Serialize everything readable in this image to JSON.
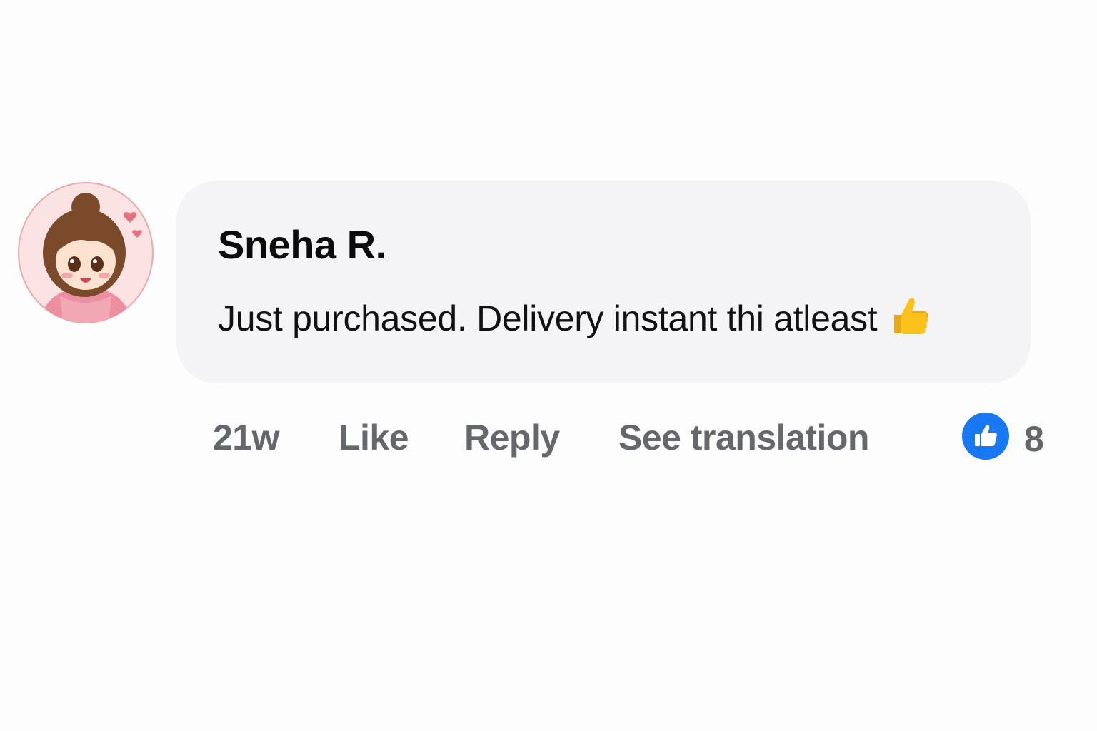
{
  "comment": {
    "author": "Sneha R.",
    "text": "Just purchased. Delivery instant thi atleast",
    "emoji": "thumbs-up-emoji",
    "avatar": "cartoon-girl-avatar"
  },
  "meta": {
    "timestamp": "21w",
    "like_label": "Like",
    "reply_label": "Reply",
    "translate_label": "See translation",
    "reaction_icon": "like-reaction-icon",
    "reaction_count": "8"
  },
  "colors": {
    "bubble": "#f4f4f6",
    "meta_text": "#65676b",
    "reaction_blue": "#1877f2"
  }
}
